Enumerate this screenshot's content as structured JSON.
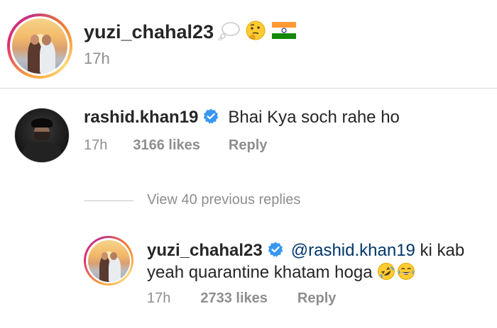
{
  "post": {
    "username": "yuzi_chahal23",
    "caption_emojis": [
      "thought-balloon-emoji",
      "thinking-face-emoji",
      "india-flag-emoji"
    ],
    "time": "17h"
  },
  "comment": {
    "username": "rashid.khan19",
    "verified": true,
    "text": "Bhai Kya soch rahe ho",
    "time": "17h",
    "likes": "3166 likes",
    "reply_label": "Reply"
  },
  "view_replies": {
    "label": "View 40 previous replies"
  },
  "reply": {
    "username": "yuzi_chahal23",
    "verified": true,
    "mention": "@rashid.khan19",
    "text_line1_rest": " ki kab",
    "text_line2": "yeah quarantine khatam hoga",
    "emojis": [
      "rolling-on-floor-laughing-emoji",
      "face-with-tears-of-joy-emoji"
    ],
    "time": "17h",
    "likes": "2733 likes",
    "reply_label": "Reply"
  },
  "colors": {
    "text": "#262626",
    "meta": "#8e8e8e",
    "mention": "#00376b",
    "verified": "#3897f0",
    "divider": "#dbdbdb"
  }
}
